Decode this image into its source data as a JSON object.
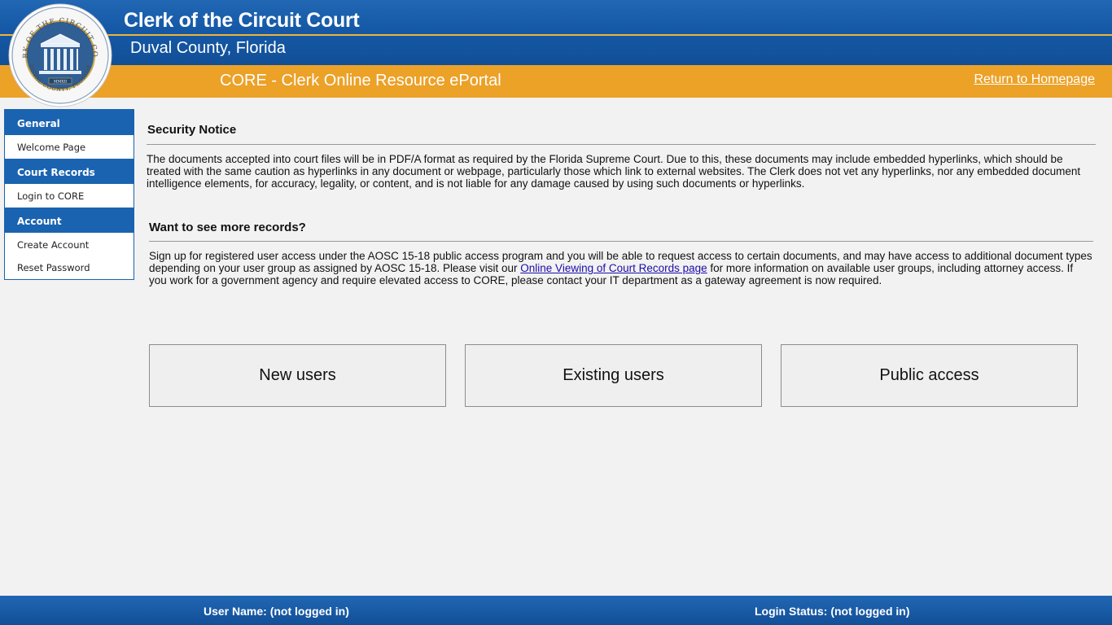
{
  "header": {
    "title": "Clerk of the Circuit Court",
    "subtitle": "Duval County, Florida",
    "portal_title": "CORE - Clerk Online Resource ePortal",
    "home_link": "Return to Homepage"
  },
  "seal": {
    "outer_text": "CLERK OF THE CIRCUIT COURT",
    "bottom_text": "DUVAL COUNTY, FLORIDA",
    "year": "MMXII"
  },
  "sidebar": {
    "sections": [
      {
        "heading": "General",
        "items": [
          "Welcome Page"
        ]
      },
      {
        "heading": "Court Records",
        "items": [
          "Login to CORE"
        ]
      },
      {
        "heading": "Account",
        "items": [
          "Create Account",
          "Reset Password"
        ]
      }
    ]
  },
  "security": {
    "heading": "Security Notice",
    "body": "The documents accepted into court files will be in PDF/A format as required by the Florida Supreme Court. Due to this, these documents may include embedded hyperlinks, which should be treated with the same caution as hyperlinks in any document or webpage, particularly those which link to external websites. The Clerk does not vet any hyperlinks, nor any embedded document intelligence elements, for accuracy, legality, or content, and is not liable for any damage caused by using such documents or hyperlinks."
  },
  "more_records": {
    "heading": "Want to see more records?",
    "body_before": "Sign up for registered user access under the AOSC 15-18 public access program and you will be able to request access to certain documents, and may have access to additional document types depending on your user group as assigned by AOSC 15-18. Please visit our ",
    "link": "Online Viewing of Court Records page",
    "body_after": " for more information on available user groups, including attorney access. If you work for a government agency and require elevated access to CORE, please contact your IT department as a gateway agreement is now required."
  },
  "buttons": {
    "new_users": "New users",
    "existing_users": "Existing users",
    "public_access": "Public access"
  },
  "footer": {
    "user_name": "User Name: (not logged in)",
    "login_status": "Login Status: (not logged in)"
  },
  "colors": {
    "header_blue": "#1559a6",
    "banner_orange": "#eca127",
    "accent_gold": "#f0b43a",
    "link_blue": "#1a0dab"
  }
}
